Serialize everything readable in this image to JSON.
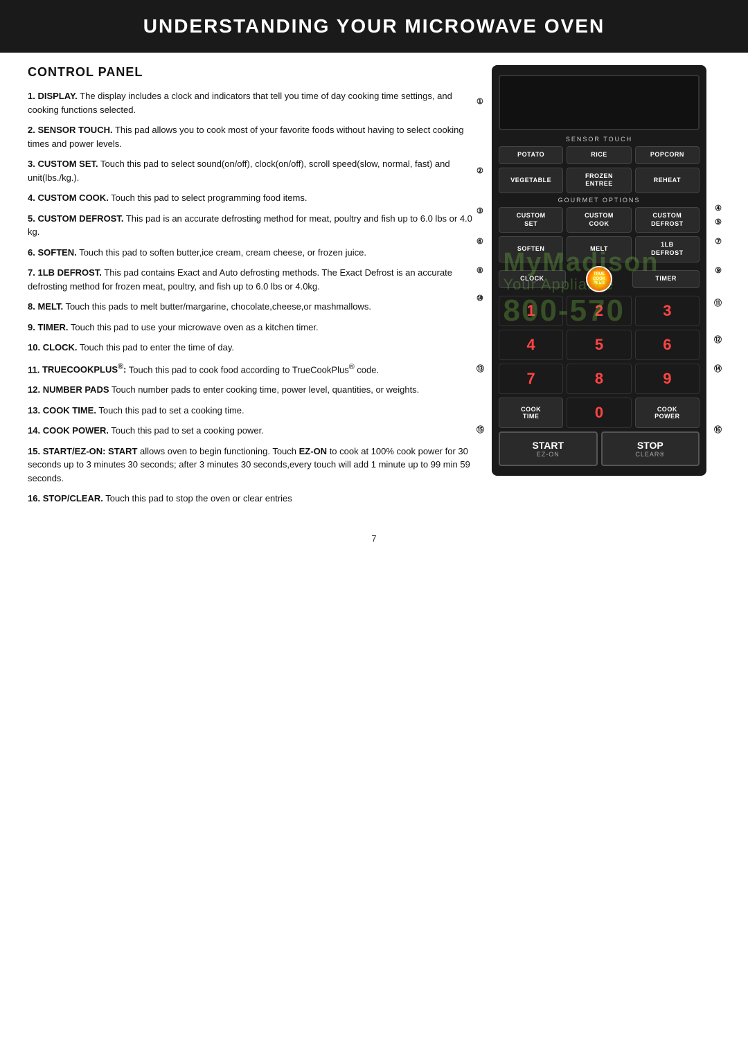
{
  "header": {
    "title": "UNDERSTANDING YOUR MICROWAVE OVEN"
  },
  "section": {
    "title": "CONTROL PANEL"
  },
  "items": [
    {
      "num": "1",
      "label": "DISPLAY.",
      "text": "The display includes a clock and indicators that tell you time of day cooking time settings, and cooking functions selected."
    },
    {
      "num": "2",
      "label": "SENSOR TOUCH.",
      "text": "This pad allows you to cook most of your favorite foods without having to select cooking times and power levels."
    },
    {
      "num": "3",
      "label": "CUSTOM SET.",
      "text": "Touch this pad to select sound(on/off), clock(on/off), scroll speed(slow, normal, fast) and unit(lbs./kg.)."
    },
    {
      "num": "4",
      "label": "CUSTOM COOK.",
      "text": "Touch this pad to select programming food items."
    },
    {
      "num": "5",
      "label": "CUSTOM DEFROST.",
      "text": "This pad is an accurate defrosting method for meat, poultry and fish up to 6.0 lbs or 4.0 kg."
    },
    {
      "num": "6",
      "label": "SOFTEN.",
      "text": "Touch this pad to soften butter,ice cream, cream cheese, or frozen juice."
    },
    {
      "num": "7",
      "label": "1LB DEFROST.",
      "text": "This pad contains Exact and Auto defrosting methods. The Exact Defrost is an accurate defrosting method for frozen meat, poultry, and fish up to 6.0 lbs or 4.0kg."
    },
    {
      "num": "8",
      "label": "MELT.",
      "text": "Touch this pads to melt butter/margarine, chocolate,cheese,or mashmallows."
    },
    {
      "num": "9",
      "label": "TIMER.",
      "text": "Touch this pad to use your microwave oven as a kitchen timer."
    },
    {
      "num": "10",
      "label": "CLOCK.",
      "text": "Touch this pad to enter the time of day."
    },
    {
      "num": "11",
      "label": "TrueCookPlus®:",
      "text": "Touch this pad to cook food according to TrueCookPlus® code."
    },
    {
      "num": "12",
      "label": "NUMBER PADS",
      "text": "Touch number pads to enter cooking time, power level, quantities, or weights."
    },
    {
      "num": "13",
      "label": "COOK TIME.",
      "text": "Touch this pad to set a cooking time."
    },
    {
      "num": "14",
      "label": "COOK POWER.",
      "text": "Touch this pad to set a cooking power."
    },
    {
      "num": "15",
      "label": "START/EZ-ON: START",
      "text": "allows oven  to begin functioning. Touch EZ-ON to cook at 100% cook power for 30 seconds up to 3 minutes 30 seconds; after 3 minutes 30 seconds,every touch will add 1 minute up to 99 min 59 seconds."
    },
    {
      "num": "16",
      "label": "STOP/CLEAR.",
      "text": "Touch this pad to stop the oven or clear entries"
    }
  ],
  "panel": {
    "sensor_touch_label": "SENSOR TOUCH",
    "gourmet_options_label": "GOURMET OPTIONS",
    "buttons": {
      "row1": [
        "POTATO",
        "RICE",
        "POPCORN"
      ],
      "row2": [
        "VEGETABLE",
        "FROZEN\nENTREE",
        "REHEAT"
      ],
      "row3": [
        "CUSTOM\nSET",
        "CUSTOM\nCOOK",
        "CUSTOM\nDEFROST"
      ],
      "row4": [
        "SOFTEN",
        "MELT",
        "1LB\nDEFROST"
      ],
      "row5_left": "CLOCK",
      "row5_right": "TIMER",
      "numpad": [
        "1",
        "2",
        "3",
        "4",
        "5",
        "6",
        "7",
        "8",
        "9"
      ],
      "cook_time": "COOK\nTIME",
      "zero": "0",
      "cook_power": "COOK\nPOWER",
      "start": "START",
      "start_sub": "EZ-ON",
      "stop": "STOP",
      "stop_sub": "CLEAR®"
    },
    "side_callouts_left": [
      "1",
      "2",
      "3",
      "6",
      "8",
      "10",
      "15"
    ],
    "side_callouts_right": [
      "4",
      "5",
      "7",
      "9",
      "11",
      "14",
      "16"
    ]
  },
  "watermark": {
    "company": "MyMadison",
    "sub": "Your Appliance",
    "phone": "800-570"
  },
  "page_number": "7"
}
